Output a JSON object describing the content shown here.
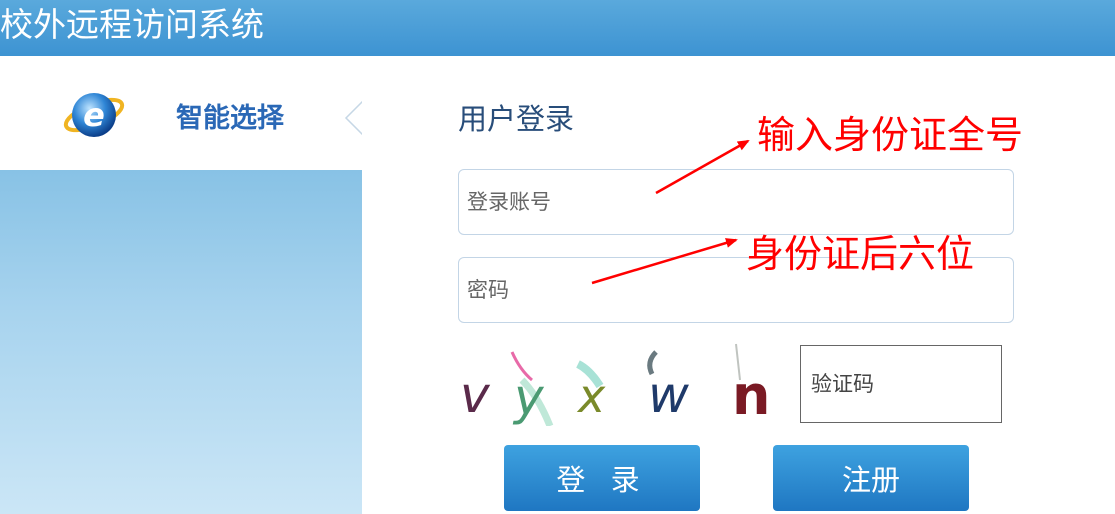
{
  "header": {
    "app_title": "校外远程访问系统"
  },
  "sidebar": {
    "items": [
      {
        "label": "智能选择",
        "icon": "ie-browser-icon"
      }
    ]
  },
  "login": {
    "title": "用户登录",
    "account_placeholder": "登录账号",
    "password_placeholder": "密码",
    "captcha_text": "vyxwn",
    "captcha_placeholder": "验证码",
    "login_label": "登 录",
    "register_label": "注册"
  },
  "annotations": {
    "account_note": "输入身份证全号",
    "password_note": "身份证后六位",
    "color": "#ff0000"
  },
  "colors": {
    "header_bg": "#4a9fd8",
    "button_bg": "#2a88d0",
    "title_text": "#284d7a",
    "sidebar_label": "#2a68b6"
  }
}
